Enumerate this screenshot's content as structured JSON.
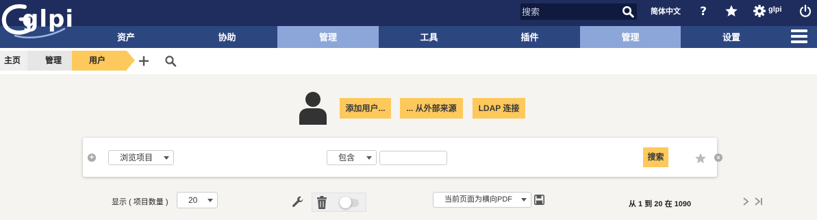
{
  "header": {
    "logo_text": "glpi",
    "search_placeholder": "搜索",
    "language": "简体中文",
    "user_name": "glpi",
    "icons": [
      "search-icon",
      "help-icon",
      "star-icon",
      "gear-icon",
      "power-icon"
    ]
  },
  "menu": {
    "items": [
      {
        "label": "资产",
        "active": false
      },
      {
        "label": "协助",
        "active": false
      },
      {
        "label": "管理",
        "active": true
      },
      {
        "label": "工具",
        "active": false
      },
      {
        "label": "插件",
        "active": false
      },
      {
        "label": "管理",
        "active": true
      },
      {
        "label": "设置",
        "active": false
      }
    ]
  },
  "breadcrumb": {
    "home": "主页",
    "manage": "管理",
    "users": "用户"
  },
  "actions": {
    "add_user": "添加用户...",
    "from_external": "... 从外部来源",
    "ldap": "LDAP 连接"
  },
  "search": {
    "field": "浏览项目",
    "operator": "包含",
    "value": "",
    "submit": "搜索"
  },
  "list": {
    "display_label": "显示 ( 项目数量 )",
    "page_size": "20",
    "export_option": "当前页面为横向PDF",
    "pagination": "从 1 到 20 在 1090"
  },
  "colors": {
    "header_bg": "#1e2d5d",
    "menu_bg": "#2c4680",
    "menu_active": "#8ca6d9",
    "accent": "#fec95c",
    "page_bg": "#f5f4f0"
  }
}
